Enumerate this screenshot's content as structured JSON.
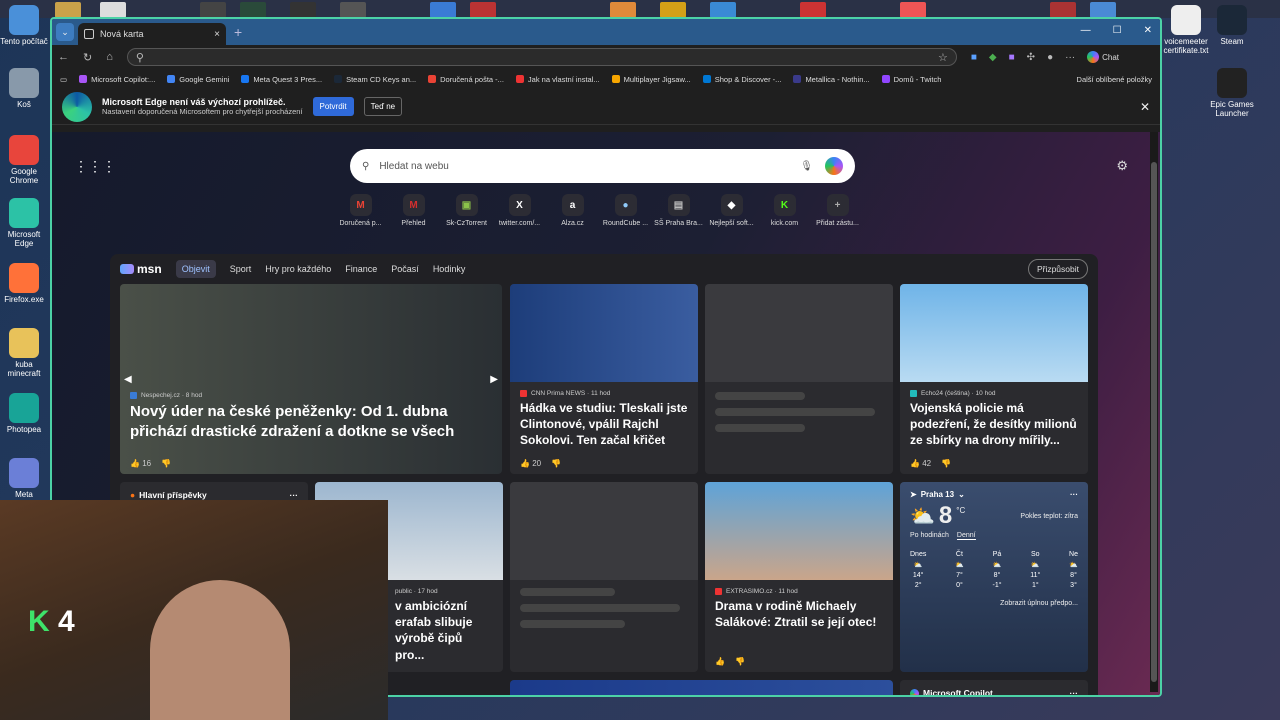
{
  "desktop": {
    "icons_left": [
      {
        "label": "Tento počítač",
        "color": "#4a90d9"
      },
      {
        "label": "Koš",
        "color": "#8899aa"
      },
      {
        "label": "Google Chrome",
        "color": "#e8453c"
      },
      {
        "label": "Microsoft Edge",
        "color": "#2cc2a6"
      },
      {
        "label": "Firefox.exe",
        "color": "#ff7139"
      },
      {
        "label": "kuba minecraft",
        "color": "#e8c25a"
      },
      {
        "label": "Photopea",
        "color": "#18a497"
      },
      {
        "label": "Meta",
        "color": "#6b7fd7"
      }
    ],
    "icons_right": [
      {
        "label": "voicemeeter certifikate.txt",
        "color": "#eeeeee"
      },
      {
        "label": "Steam",
        "color": "#1b2838"
      },
      {
        "label": "Epic Games Launcher",
        "color": "#222222"
      }
    ]
  },
  "browser": {
    "tab_title": "Nová karta",
    "new_tab_glyph": "+",
    "close_glyph": "×",
    "address_value": "",
    "chat_label": "Chat",
    "favorites": [
      "Microsoft Copilot:...",
      "Google Gemini",
      "Meta Quest 3 Pres...",
      "Steam CD Keys an...",
      "Doručená pošta -...",
      "Jak na vlastní instal...",
      "Multiplayer Jigsaw...",
      "Shop & Discover -...",
      "Metallica - Nothin...",
      "Domů - Twitch"
    ],
    "favorites_more": "Další oblíbené položky",
    "notify": {
      "title": "Microsoft Edge není váš výchozí prohlížeč.",
      "subtitle": "Nastavení doporučená Microsoftem pro chytřejší procházení",
      "confirm": "Potvrdit",
      "later": "Teď ne"
    }
  },
  "newtab": {
    "search_placeholder": "Hledat na webu",
    "quick_links": [
      {
        "label": "Doručená p...",
        "glyph": "M",
        "color": "#ea4335"
      },
      {
        "label": "Přehled",
        "glyph": "M",
        "color": "#d32f2f"
      },
      {
        "label": "Sk-CzTorrent",
        "glyph": "▣",
        "color": "#8bc34a"
      },
      {
        "label": "twitter.com/...",
        "glyph": "X",
        "color": "#ffffff"
      },
      {
        "label": "Alza.cz",
        "glyph": "a",
        "color": "#ffffff"
      },
      {
        "label": "RoundCube ...",
        "glyph": "●",
        "color": "#90caf9"
      },
      {
        "label": "SŠ Praha Bra...",
        "glyph": "▤",
        "color": "#bbbbbb"
      },
      {
        "label": "Nejlepší soft...",
        "glyph": "◆",
        "color": "#ffffff"
      },
      {
        "label": "kick.com",
        "glyph": "K",
        "color": "#53fc18"
      },
      {
        "label": "Přidat zástu...",
        "glyph": "+",
        "color": "#aaaaaa"
      }
    ],
    "msn": {
      "logo": "msn",
      "nav": [
        "Objevit",
        "Sport",
        "Hry pro každého",
        "Finance",
        "Počasí",
        "Hodinky"
      ],
      "personalize": "Přizpůsobit",
      "hero": {
        "source": "Nespechej.cz · 8 hod",
        "title": "Nový úder na české peněženky: Od 1. dubna přichází drastické zdražení a dotkne se všech",
        "likes": "16"
      },
      "card1": {
        "source": "CNN Prima NEWS · 11 hod",
        "title": "Hádka ve studiu: Tleskali jste Clintonové, vpálil Rajchl Sokolovi. Ten začal křičet",
        "likes": "20"
      },
      "card3": {
        "source": "Echo24 (čeština) · 10 hod",
        "title": "Vojenská policie má podezření, že desítky milionů ze sbírky na drony mířily...",
        "likes": "42"
      },
      "card4": {
        "source": "public · 17 hod",
        "title": "v ambiciózní erafab slibuje výrobě čipů pro..."
      },
      "card5": {
        "source": "EXTRASIMO.cz · 11 hod",
        "title": "Drama v rodině Michaely Salákové: Ztratil se její otec!"
      },
      "highlights": "Hlavní příspěvky",
      "copilot": "Microsoft Copilot",
      "weather": {
        "location": "Praha 13",
        "temp": "8",
        "unit": "°C",
        "note": "Pokles teplot: zítra",
        "tab_hourly": "Po hodinách",
        "tab_daily": "Denní",
        "days": [
          {
            "d": "Dnes",
            "hi": "14°",
            "lo": "2°"
          },
          {
            "d": "Čt",
            "hi": "7°",
            "lo": "0°"
          },
          {
            "d": "Pá",
            "hi": "8°",
            "lo": "-1°"
          },
          {
            "d": "So",
            "hi": "11°",
            "lo": "1°"
          },
          {
            "d": "Ne",
            "hi": "8°",
            "lo": "3°"
          }
        ],
        "full": "Zobrazit úplnou předpo..."
      }
    }
  },
  "webcam": {
    "overlay": "K",
    "overlay2": "4"
  }
}
